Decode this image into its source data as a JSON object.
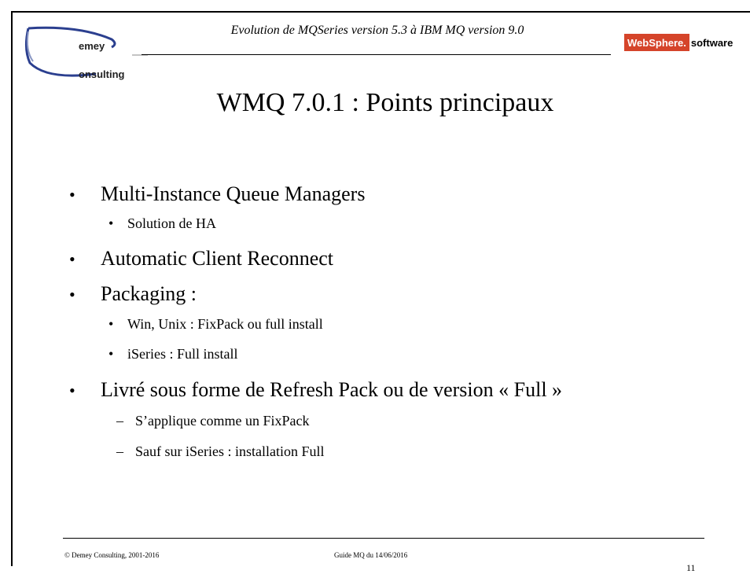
{
  "header": {
    "title": "Evolution de MQSeries version 5.3 à IBM MQ version 9.0",
    "logo_text_1": "emey",
    "logo_text_2": "onsulting",
    "badge_brand": "WebSphere.",
    "badge_suffix": "software"
  },
  "slide": {
    "title": "WMQ 7.0.1 : Points principaux",
    "items": [
      {
        "marker": "•",
        "text": "Multi-Instance Queue Managers"
      },
      {
        "marker": "•",
        "text": "Solution de HA"
      },
      {
        "marker": "•",
        "text": "Automatic Client Reconnect"
      },
      {
        "marker": "•",
        "text": "Packaging :"
      },
      {
        "marker": "•",
        "text": "Win, Unix : FixPack ou full install"
      },
      {
        "marker": "•",
        "text": "iSeries : Full install"
      },
      {
        "marker": "•",
        "text": "Livré sous forme de Refresh Pack ou de version « Full »"
      },
      {
        "marker": "–",
        "text": "S’applique comme un FixPack"
      },
      {
        "marker": "–",
        "text": "Sauf sur iSeries : installation Full"
      }
    ]
  },
  "footer": {
    "copyright": "© Demey Consulting, 2001-2016",
    "guide": "Guide MQ du 14/06/2016",
    "page_number": "11"
  },
  "colors": {
    "logo_blue": "#2b3f8f",
    "badge_red": "#d5442a"
  }
}
